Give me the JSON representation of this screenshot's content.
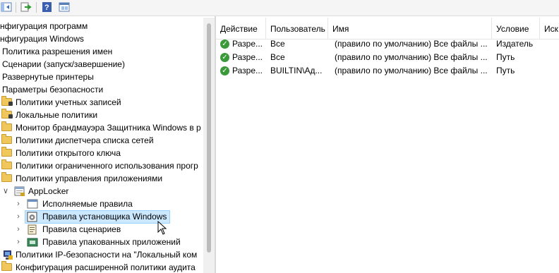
{
  "tree": {
    "items": [
      {
        "label": "нфигурация программ"
      },
      {
        "label": "нфигурация Windows"
      },
      {
        "label": "Политика разрешения имен"
      },
      {
        "label": "Сценарии (запуск/завершение)"
      },
      {
        "label": "Развернутые принтеры"
      },
      {
        "label": "Параметры безопасности"
      },
      {
        "label": "Политики учетных записей"
      },
      {
        "label": "Локальные политики"
      },
      {
        "label": "Монитор брандмауэра Защитника Windows в р"
      },
      {
        "label": "Политики диспетчера списка сетей"
      },
      {
        "label": "Политики открытого ключа"
      },
      {
        "label": "Политики ограниченного использования прогр"
      },
      {
        "label": "Политики управления приложениями"
      },
      {
        "label": "AppLocker"
      },
      {
        "label": "Исполняемые правила"
      },
      {
        "label": "Правила установщика Windows"
      },
      {
        "label": "Правила сценариев"
      },
      {
        "label": "Правила упакованных приложений"
      },
      {
        "label": "Политики IP-безопасности на \"Локальный ком"
      },
      {
        "label": "Конфигурация расширенной политики аудита"
      }
    ]
  },
  "list": {
    "columns": [
      "Действие",
      "Пользователь",
      "Имя",
      "Условие",
      "Иск"
    ],
    "rows": [
      {
        "action": "Разре...",
        "user": "Все",
        "name": "(правило по умолчанию) Все файлы ...",
        "condition": "Издатель"
      },
      {
        "action": "Разре...",
        "user": "Все",
        "name": "(правило по умолчанию) Все файлы ...",
        "condition": "Путь"
      },
      {
        "action": "Разре...",
        "user": "BUILTIN\\Ад...",
        "name": "(правило по умолчанию) Все файлы ...",
        "condition": "Путь"
      }
    ]
  },
  "icons": {
    "toolbar": [
      "back-icon",
      "export-list-icon",
      "help-icon",
      "show-hide-pane-icon"
    ],
    "status_allow": "green-check-icon"
  },
  "colors": {
    "selection_bg": "#cce8ff",
    "selection_border": "#99d1ff",
    "check_green": "#3a9a3a",
    "folder": "#f0c75a"
  }
}
